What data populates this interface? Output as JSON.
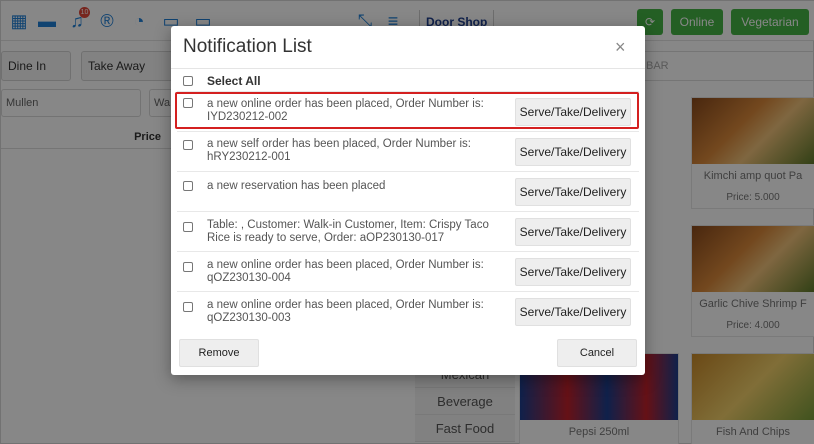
{
  "topbar": {
    "icons": [
      "grid-icon",
      "ticket-icon",
      "bell-icon",
      "registered-icon",
      "dashboard-icon",
      "monitor-icon",
      "screen-icon",
      "fullscreen-icon",
      "menu-icon"
    ],
    "bell_badge": "10",
    "shop_name": "Door Shop",
    "sync_icon": "sync-icon",
    "online_label": "Online",
    "vegetarian_label": "Vegetarian"
  },
  "left_panel": {
    "tab_dine_in": "Dine In",
    "tab_take_away": "Take Away",
    "customer_value": "Mullen",
    "waiter_value": "Wa",
    "price_header": "Price"
  },
  "right_panel": {
    "search_placeholder": "BAR",
    "categories": [
      "Mexican",
      "Beverage",
      "Fast Food"
    ],
    "items": [
      {
        "name": "Kimchi amp quot Pa",
        "price": "Price: 5.000"
      },
      {
        "name": "Garlic Chive Shrimp F",
        "price": "Price: 4.000"
      },
      {
        "name": "Pepsi 250ml",
        "price": ""
      },
      {
        "name": "Fish And Chips",
        "price": ""
      }
    ]
  },
  "modal": {
    "title": "Notification List",
    "close_glyph": "×",
    "select_all": "Select All",
    "notifications": [
      {
        "message": "a new online order has been placed, Order Number is: IYD230212-002",
        "action": "Serve/Take/Delivery"
      },
      {
        "message": "a new self order has been placed, Order Number is: hRY230212-001",
        "action": "Serve/Take/Delivery"
      },
      {
        "message": "a new reservation has been placed",
        "action": "Serve/Take/Delivery"
      },
      {
        "message": "Table: , Customer: Walk-in Customer, Item: Crispy Taco Rice is ready to serve, Order: aOP230130-017",
        "action": "Serve/Take/Delivery"
      },
      {
        "message": "a new online order has been placed, Order Number is: qOZ230130-004",
        "action": "Serve/Take/Delivery"
      },
      {
        "message": "a new online order has been placed, Order Number is: qOZ230130-003",
        "action": "Serve/Take/Delivery"
      }
    ],
    "remove_label": "Remove",
    "cancel_label": "Cancel"
  },
  "colors": {
    "brand_green": "#44b345",
    "brand_blue": "#1f7fd6",
    "highlight_red": "#d42020"
  }
}
